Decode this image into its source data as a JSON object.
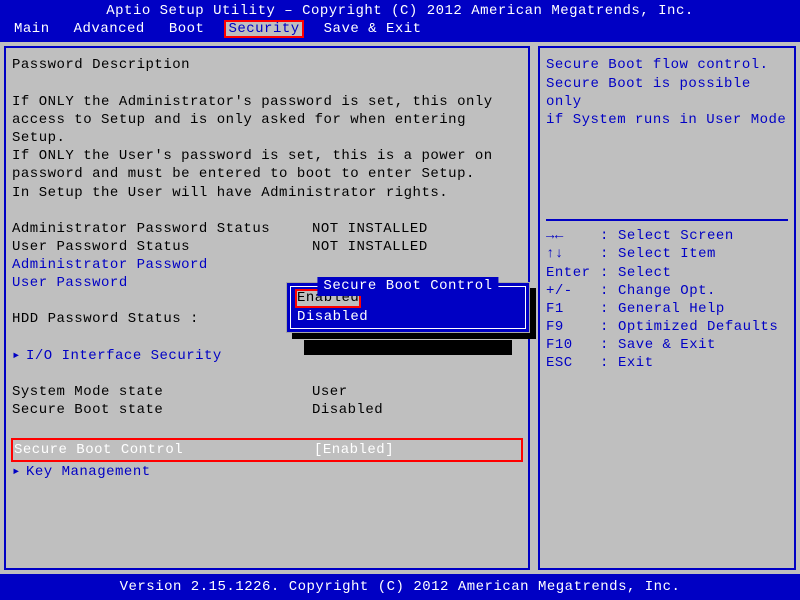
{
  "header": {
    "title": "Aptio Setup Utility – Copyright (C) 2012 American Megatrends, Inc."
  },
  "menu": {
    "items": [
      "Main",
      "Advanced",
      "Boot",
      "Security",
      "Save & Exit"
    ],
    "active_index": 3
  },
  "left": {
    "heading": "Password Description",
    "desc_lines": [
      "If ONLY the Administrator's password is set, this only",
      "access to Setup and is only asked for when entering Setup.",
      "If ONLY the User's password is set, this is a power on",
      "password and must be entered to boot to enter Setup.",
      "In Setup the User will have Administrator rights."
    ],
    "rows": [
      {
        "label": "Administrator Password Status",
        "value": "NOT INSTALLED",
        "link": false
      },
      {
        "label": "User Password Status",
        "value": "NOT INSTALLED",
        "link": false
      },
      {
        "label": "Administrator Password",
        "value": "",
        "link": true
      },
      {
        "label": "User Password",
        "value": "",
        "link": true
      }
    ],
    "hdd_row": {
      "label": "HDD Password Status  :",
      "value": ""
    },
    "submenu1": "I/O Interface Security",
    "state_rows": [
      {
        "label": "System Mode state",
        "value": "User"
      },
      {
        "label": "Secure Boot state",
        "value": "Disabled"
      }
    ],
    "selected": {
      "label": "Secure Boot Control",
      "value": "[Enabled]"
    },
    "submenu2": "Key Management"
  },
  "popup": {
    "title": "Secure Boot Control",
    "options": [
      "Enabled",
      "Disabled"
    ],
    "selected_index": 0
  },
  "right": {
    "help_top_lines": [
      "Secure Boot flow control.",
      "Secure Boot is possible only",
      "if System runs in User Mode"
    ],
    "keys": [
      {
        "key": "→←",
        "sep": ":",
        "text": "Select Screen"
      },
      {
        "key": "↑↓",
        "sep": ":",
        "text": "Select Item"
      },
      {
        "key": "Enter",
        "sep": ":",
        "text": "Select"
      },
      {
        "key": "+/-",
        "sep": ":",
        "text": "Change Opt."
      },
      {
        "key": "F1",
        "sep": ":",
        "text": "General Help"
      },
      {
        "key": "F9",
        "sep": ":",
        "text": "Optimized Defaults"
      },
      {
        "key": "F10",
        "sep": ":",
        "text": "Save & Exit"
      },
      {
        "key": "ESC",
        "sep": ":",
        "text": "Exit"
      }
    ]
  },
  "footer": {
    "text": "Version 2.15.1226. Copyright (C) 2012 American Megatrends, Inc."
  }
}
